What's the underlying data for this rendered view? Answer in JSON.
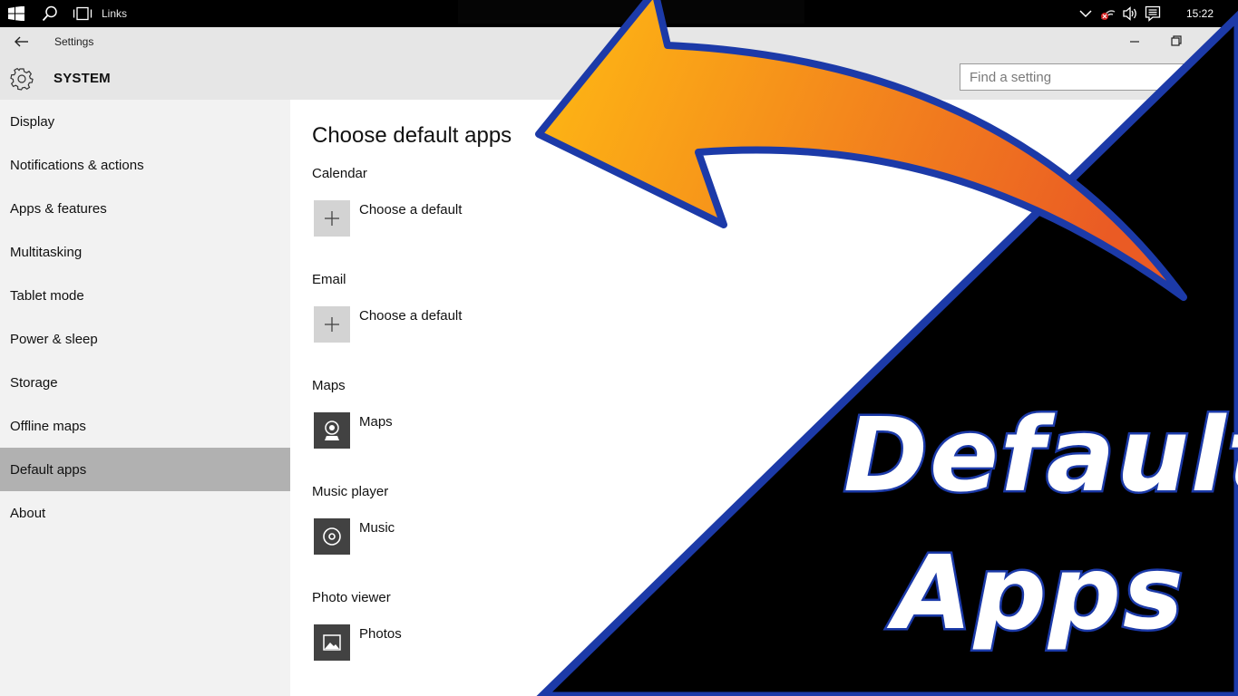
{
  "taskbar": {
    "links_label": "Links",
    "clock": "15:22",
    "icons": [
      "windows-start-icon",
      "search-icon",
      "task-view-icon",
      "chevron-up-icon",
      "network-icon",
      "volume-icon",
      "action-center-icon"
    ]
  },
  "window": {
    "title": "Settings"
  },
  "header": {
    "section_title": "SYSTEM",
    "search_placeholder": "Find a setting"
  },
  "sidebar": {
    "items": [
      {
        "label": "Display",
        "active": false
      },
      {
        "label": "Notifications & actions",
        "active": false
      },
      {
        "label": "Apps & features",
        "active": false
      },
      {
        "label": "Multitasking",
        "active": false
      },
      {
        "label": "Tablet mode",
        "active": false
      },
      {
        "label": "Power & sleep",
        "active": false
      },
      {
        "label": "Storage",
        "active": false
      },
      {
        "label": "Offline maps",
        "active": false
      },
      {
        "label": "Default apps",
        "active": true
      },
      {
        "label": "About",
        "active": false
      }
    ]
  },
  "main": {
    "page_title": "Choose default apps",
    "sections": [
      {
        "label": "Calendar",
        "app": "Choose a default",
        "icon": "plus-icon"
      },
      {
        "label": "Email",
        "app": "Choose a default",
        "icon": "plus-icon"
      },
      {
        "label": "Maps",
        "app": "Maps",
        "icon": "maps-icon"
      },
      {
        "label": "Music player",
        "app": "Music",
        "icon": "music-icon"
      },
      {
        "label": "Photo viewer",
        "app": "Photos",
        "icon": "photos-icon"
      }
    ]
  },
  "overlay": {
    "line1": "Default",
    "line2": "Apps",
    "colors": {
      "arrow_start": "#ffbb13",
      "arrow_end": "#ea5b24",
      "outline": "#1c3aa8",
      "triangle": "#000000"
    }
  }
}
